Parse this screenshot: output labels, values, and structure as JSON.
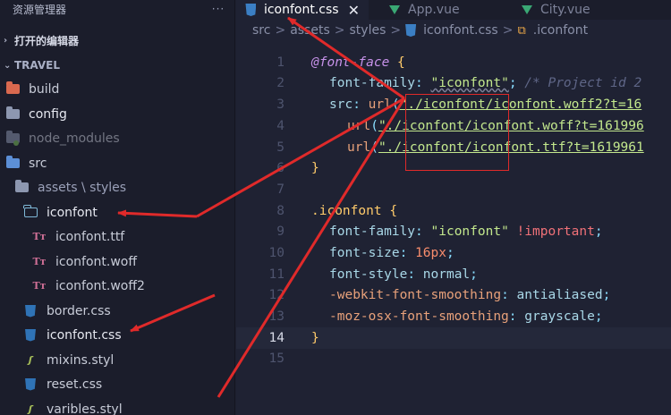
{
  "explorer": {
    "title": "资源管理器",
    "more": "···",
    "open_editors": "打开的编辑器",
    "workspace": "TRAVEL",
    "items": [
      {
        "label": "build",
        "kind": "folder-build"
      },
      {
        "label": "config",
        "kind": "folder-config"
      },
      {
        "label": "node_modules",
        "kind": "folder-node"
      },
      {
        "label": "src",
        "kind": "folder-src"
      },
      {
        "label": "assets \\ styles",
        "kind": "folder"
      },
      {
        "label": "iconfont",
        "kind": "folder-open"
      },
      {
        "label": "iconfont.ttf",
        "kind": "font"
      },
      {
        "label": "iconfont.woff",
        "kind": "font"
      },
      {
        "label": "iconfont.woff2",
        "kind": "font"
      },
      {
        "label": "border.css",
        "kind": "css"
      },
      {
        "label": "iconfont.css",
        "kind": "css"
      },
      {
        "label": "mixins.styl",
        "kind": "styl"
      },
      {
        "label": "reset.css",
        "kind": "css"
      },
      {
        "label": "varibles.styl",
        "kind": "styl"
      }
    ]
  },
  "tabs": [
    {
      "label": "iconfont.css",
      "close": "✕"
    },
    {
      "label": "App.vue"
    },
    {
      "label": "City.vue"
    }
  ],
  "breadcrumb": {
    "parts": [
      "src",
      "assets",
      "styles",
      "iconfont.css",
      ".iconfont"
    ],
    "sep": ">"
  },
  "code": {
    "line_numbers": [
      "1",
      "2",
      "3",
      "4",
      "5",
      "6",
      "7",
      "8",
      "9",
      "10",
      "11",
      "12",
      "13",
      "14",
      "15"
    ],
    "current_line": "14",
    "l1": [
      "@font-face",
      "{"
    ],
    "l2": [
      "font-family",
      ": ",
      "\"iconfont\"",
      ";",
      " /* Project id 2"
    ],
    "l3": [
      "src",
      ": ",
      "url",
      "(",
      "\"./iconfont/iconfont.woff2?t=16"
    ],
    "l4": [
      "url",
      "(",
      "\"./iconfont/iconfont.woff?t=161996"
    ],
    "l5": [
      "url",
      "(",
      "\"./iconfont/iconfont.ttf?t=1619961"
    ],
    "l6": [
      "}"
    ],
    "l8": [
      ".iconfont",
      "{"
    ],
    "l9": [
      "font-family",
      ": ",
      "\"iconfont\"",
      " ",
      "!important",
      ";"
    ],
    "l10": [
      "font-size",
      ": ",
      "16px",
      ";"
    ],
    "l11": [
      "font-style",
      ": ",
      "normal",
      ";"
    ],
    "l12": [
      "-webkit-font-smoothing",
      ": ",
      "antialiased",
      ";"
    ],
    "l13": [
      "-moz-osx-font-smoothing",
      ": ",
      "grayscale",
      ";"
    ],
    "l14": [
      "}"
    ]
  },
  "colors": {
    "annotation": "#e02a2a",
    "tab_active_underline": "#ffffff"
  }
}
